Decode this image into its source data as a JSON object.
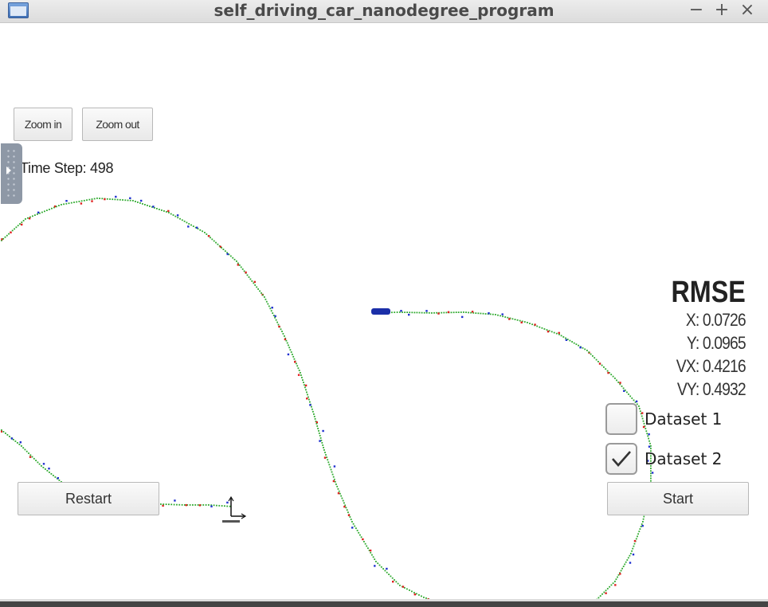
{
  "window": {
    "title": "self_driving_car_nanodegree_program",
    "minimize_glyph": "−",
    "maximize_glyph": "+",
    "close_glyph": "×"
  },
  "toolbar": {
    "zoom_in_label": "Zoom in",
    "zoom_out_label": "Zoom out"
  },
  "status": {
    "time_step_text": "Time Step: 498"
  },
  "rmse": {
    "title": "RMSE",
    "x_text": "X: 0.0726",
    "y_text": "Y: 0.0965",
    "vx_text": "VX: 0.4216",
    "vy_text": "VY: 0.4932"
  },
  "datasets": [
    {
      "label": "Dataset 1",
      "checked": false
    },
    {
      "label": "Dataset 2",
      "checked": true
    }
  ],
  "buttons": {
    "restart_label": "Restart",
    "start_label": "Start"
  },
  "colors": {
    "ground_truth": "#2eaa2e",
    "lidar": "#e02020",
    "radar": "#2030d0",
    "vehicle": "#1b2fa8"
  },
  "icons": {
    "app": "window-app-icon",
    "axes": "coordinate-axes-icon",
    "vehicle": "car-icon",
    "panel_handle": "panel-handle-icon"
  }
}
